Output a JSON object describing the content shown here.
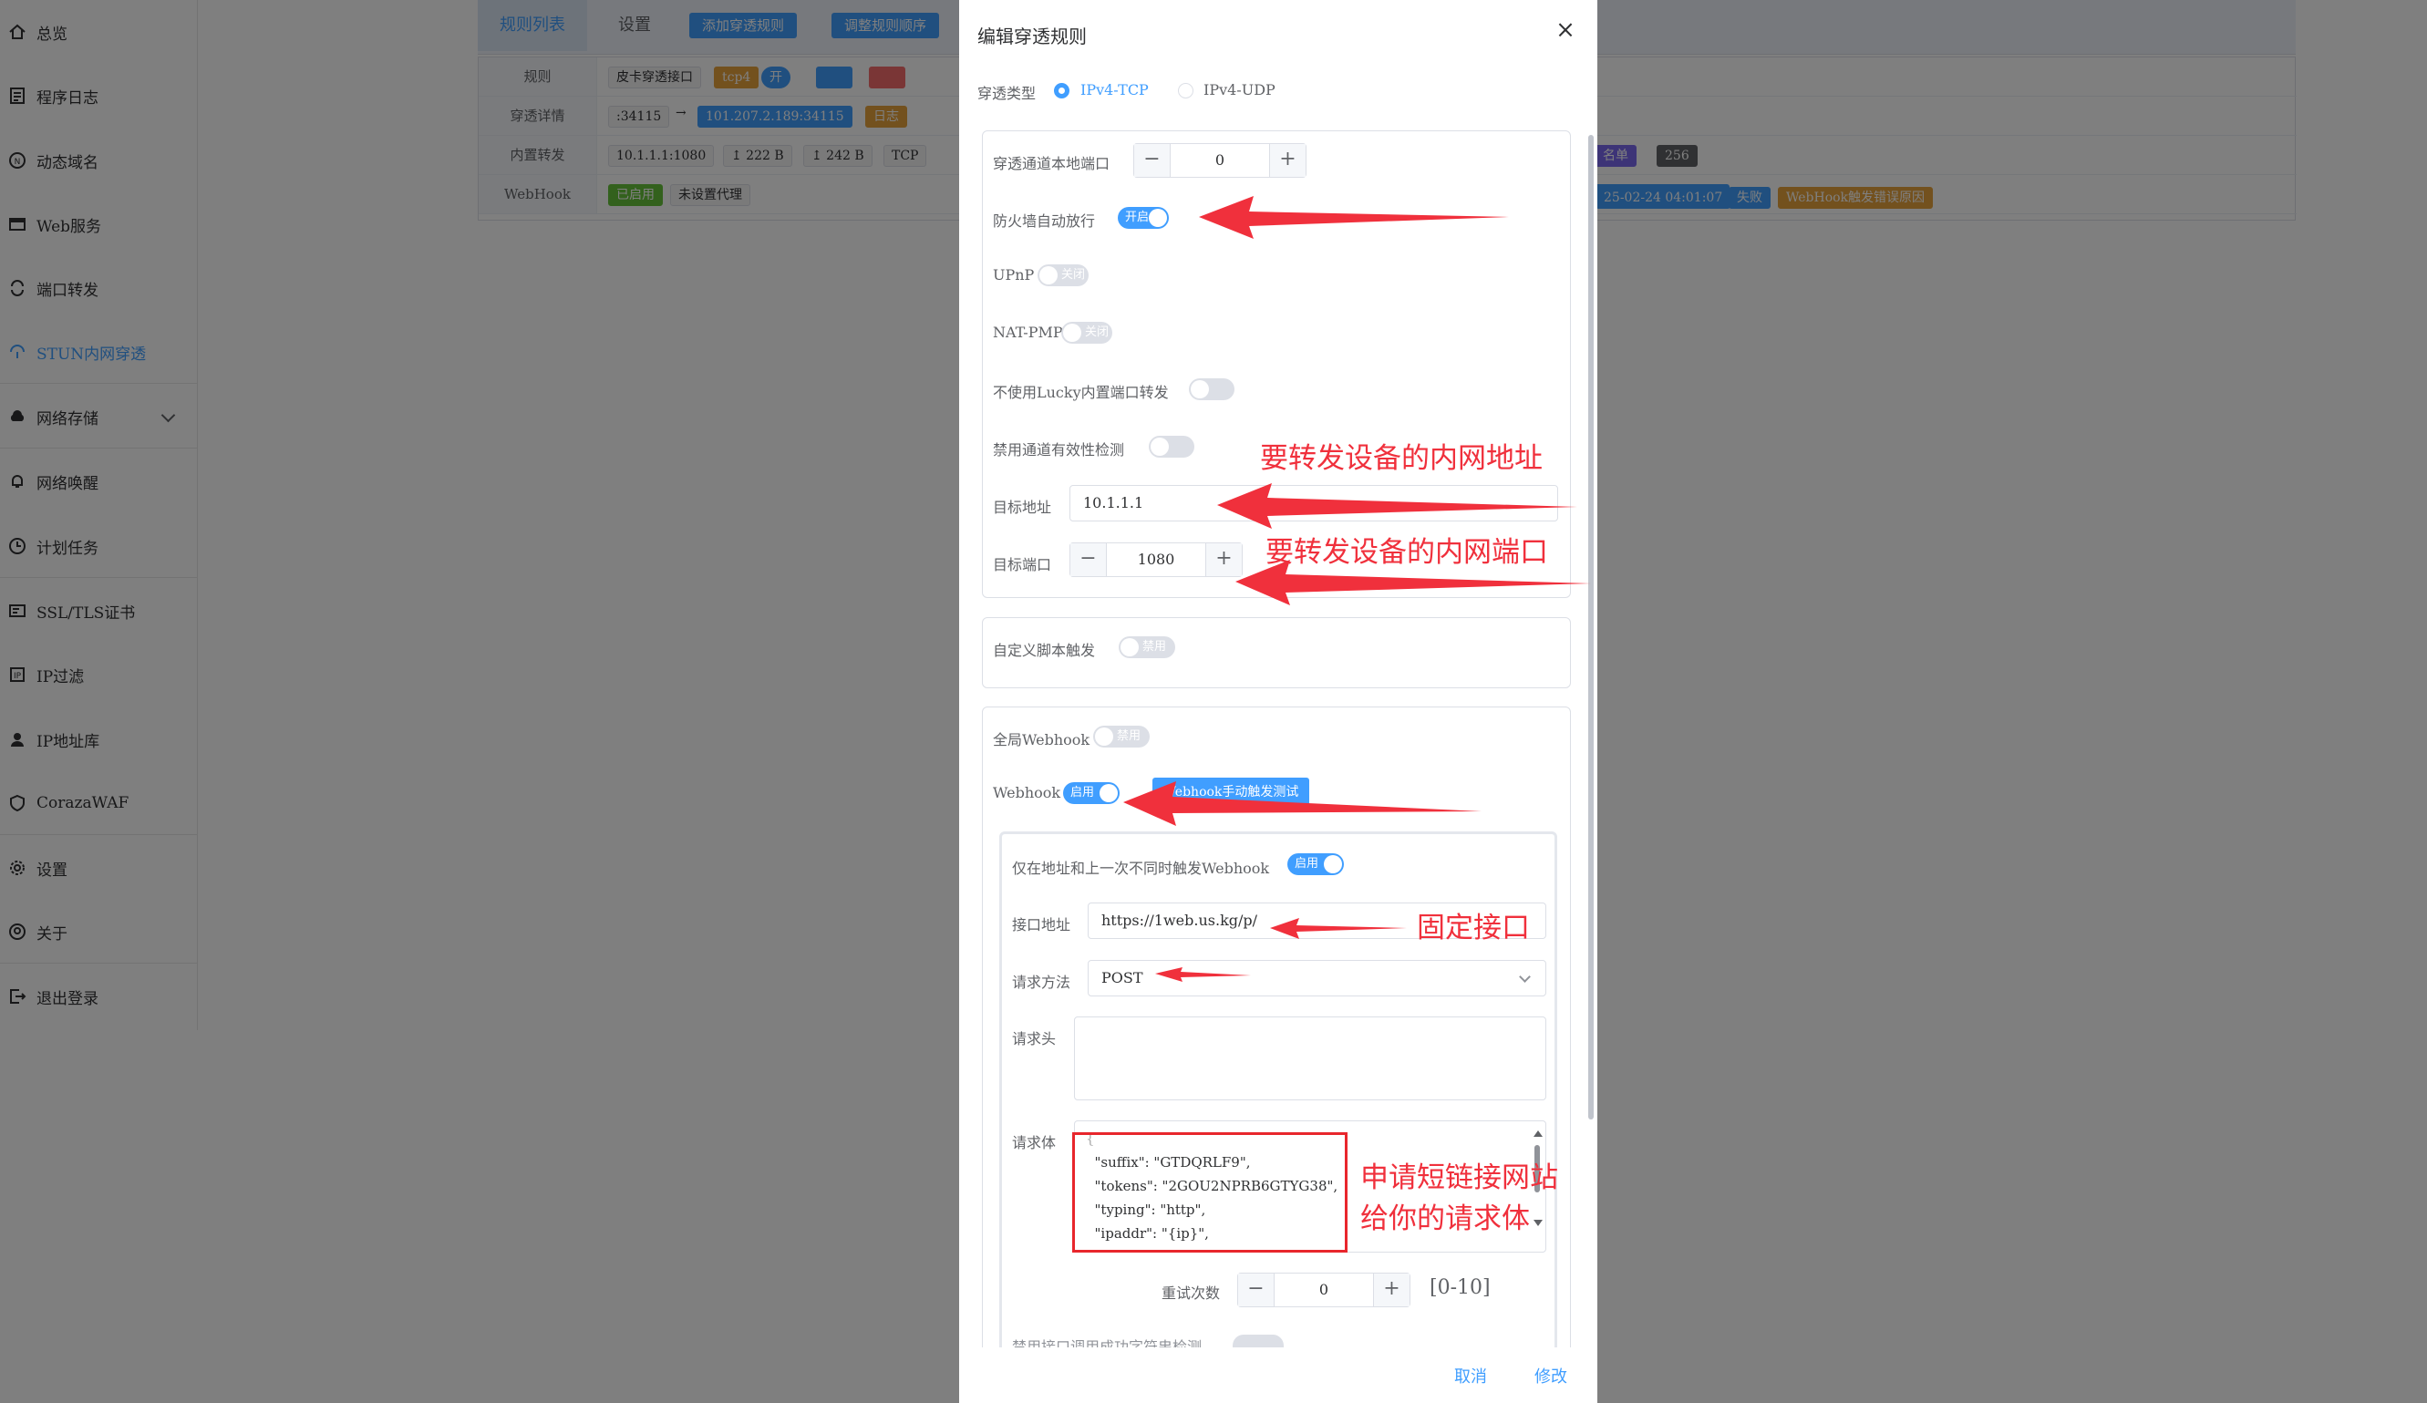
{
  "sidebar": {
    "items": [
      {
        "label": "总览",
        "icon": "home-icon"
      },
      {
        "label": "程序日志",
        "icon": "log-icon"
      },
      {
        "label": "动态域名",
        "icon": "ddns-icon"
      },
      {
        "label": "Web服务",
        "icon": "web-icon"
      },
      {
        "label": "端口转发",
        "icon": "forward-icon"
      },
      {
        "label": "STUN内网穿透",
        "icon": "stun-icon"
      },
      {
        "label": "网络存储",
        "icon": "cloud-icon"
      },
      {
        "label": "网络唤醒",
        "icon": "bell-icon"
      },
      {
        "label": "计划任务",
        "icon": "clock-icon"
      },
      {
        "label": "SSL/TLS证书",
        "icon": "cert-icon"
      },
      {
        "label": "IP过滤",
        "icon": "filter-icon"
      },
      {
        "label": "IP地址库",
        "icon": "user-icon"
      },
      {
        "label": "CorazaWAF",
        "icon": "shield-icon"
      },
      {
        "label": "设置",
        "icon": "gear-icon"
      },
      {
        "label": "关于",
        "icon": "about-icon"
      },
      {
        "label": "退出登录",
        "icon": "logout-icon"
      }
    ]
  },
  "main": {
    "tabs": {
      "rules": "规则列表",
      "settings": "设置"
    },
    "buttons": {
      "add_rule": "添加穿透规则",
      "reorder": "调整规则顺序"
    },
    "table": {
      "rule_label": "规则",
      "rule_name": "皮卡穿透接口",
      "rule_proto": "tcp4",
      "rule_toggle": "开",
      "detail_label": "穿透详情",
      "detail_port": ":34115",
      "detail_arrow": "→",
      "detail_addr": "101.207.2.189:34115",
      "detail_log": "日志",
      "inner_label": "内置转发",
      "inner_addr": "10.1.1.1:1080",
      "inner_up": "↥ 222 B",
      "inner_down": "↥ 242 B",
      "inner_proto": "TCP",
      "inner_list": "名单",
      "inner_count": "256",
      "webhook_label": "WebHook",
      "webhook_enabled": "已启用",
      "webhook_proxy": "未设置代理",
      "webhook_time": "25-02-24 04:01:07",
      "webhook_status": "失败",
      "webhook_reason": "WebHook触发错误原因"
    }
  },
  "dialog": {
    "title": "编辑穿透规则",
    "type_label": "穿透类型",
    "type_tcp": "IPv4-TCP",
    "type_udp": "IPv4-UDP",
    "local_port_label": "穿透通道本地端口",
    "local_port_value": "0",
    "firewall_label": "防火墙自动放行",
    "firewall_switch": "开启",
    "upnp_label": "UPnP",
    "upnp_switch": "关闭",
    "natpmp_label": "NAT-PMP",
    "natpmp_switch": "关闭",
    "no_lucky_label": "不使用Lucky内置端口转发",
    "disable_check_label": "禁用通道有效性检测",
    "target_addr_label": "目标地址",
    "target_addr_value": "10.1.1.1",
    "target_port_label": "目标端口",
    "target_port_value": "1080",
    "script_label": "自定义脚本触发",
    "script_switch": "禁用",
    "global_webhook_label": "全局Webhook",
    "global_webhook_switch": "禁用",
    "webhook_label": "Webhook",
    "webhook_switch": "启用",
    "webhook_test_button": "Webhook手动触发测试",
    "only_diff_label": "仅在地址和上一次不同时触发Webhook",
    "only_diff_switch": "启用",
    "api_label": "接口地址",
    "api_value": "https://1web.us.kg/p/",
    "method_label": "请求方法",
    "method_value": "POST",
    "headers_label": "请求头",
    "body_label": "请求体",
    "body_lines": [
      "{",
      "  \"suffix\": \"GTDQRLF9\",",
      "  \"tokens\": \"2GOU2NPRB6GTYG38\",",
      "  \"typing\": \"http\",",
      "  \"ipaddr\": \"{ip}\","
    ],
    "retry_label": "重试次数",
    "retry_value": "0",
    "retry_range": "[0-10]",
    "cut_label": "禁用接口调用成功字符串检测",
    "cancel": "取消",
    "confirm": "修改"
  },
  "annotations": {
    "inner_addr": "要转发设备的内网地址",
    "inner_port": "要转发设备的内网端口",
    "fixed_api": "固定接口",
    "body_note_1": "申请短链接网站",
    "body_note_2": "给你的请求体"
  },
  "colors": {
    "accent": "#409eff",
    "annotation": "#f0303c",
    "overlay": "rgba(0,0,0,0.5)"
  }
}
